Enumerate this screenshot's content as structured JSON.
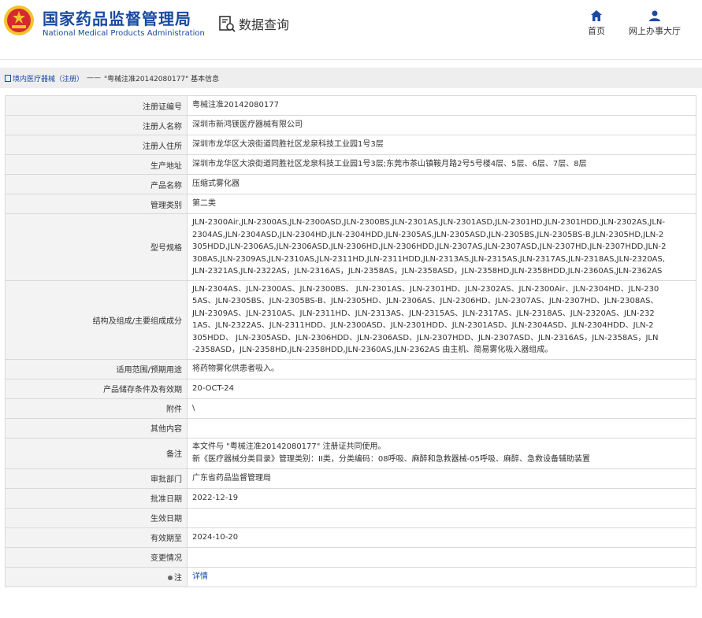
{
  "header": {
    "brand_cn": "国家药品监督管理局",
    "brand_en": "National Medical Products Administration",
    "search_title": "数据查询",
    "nav_home": "首页",
    "nav_office": "网上办事大厅"
  },
  "breadcrumb": {
    "link": "境内医疗器械（注册）",
    "separator": "——",
    "current": "\"粤械注准20142080177\" 基本信息"
  },
  "rows": [
    {
      "key": "注册证编号",
      "value": "粤械注准20142080177"
    },
    {
      "key": "注册人名称",
      "value": "深圳市新鸿镁医疗器械有限公司"
    },
    {
      "key": "注册人住所",
      "value": "深圳市龙华区大浪街道同胜社区龙泉科技工业园1号3层"
    },
    {
      "key": "生产地址",
      "value": "深圳市龙华区大浪街道同胜社区龙泉科技工业园1号3层;东莞市茶山镇鞍月路2号5号楼4层、5层、6层、7层、8层"
    },
    {
      "key": "产品名称",
      "value": "压缩式雾化器"
    },
    {
      "key": "管理类别",
      "value": "第二类"
    },
    {
      "key": "型号规格",
      "lines": [
        "JLN-2300Air,JLN-2300AS,JLN-2300ASD,JLN-2300BS,JLN-2301AS,JLN-2301ASD,JLN-2301HD,JLN-2301HDD,JLN-2302AS,JLN-",
        "2304AS,JLN-2304ASD,JLN-2304HD,JLN-2304HDD,JLN-2305AS,JLN-2305ASD,JLN-2305BS,JLN-2305BS-B,JLN-2305HD,JLN-2",
        "305HDD,JLN-2306AS,JLN-2306ASD,JLN-2306HD,JLN-2306HDD,JLN-2307AS,JLN-2307ASD,JLN-2307HD,JLN-2307HDD,JLN-2",
        "308AS,JLN-2309AS,JLN-2310AS,JLN-2311HD,JLN-2311HDD,JLN-2313AS,JLN-2315AS,JLN-2317AS,JLN-2318AS,JLN-2320AS,",
        "JLN-2321AS,JLN-2322AS，JLN-2316AS，JLN-2358AS，JLN-2358ASD，JLN-2358HD,JLN-2358HDD,JLN-2360AS,JLN-2362AS"
      ]
    },
    {
      "key": "结构及组成/主要组成成分",
      "lines": [
        "JLN-2304AS、JLN-2300AS、JLN-2300BS、 JLN-2301AS、JLN-2301HD、JLN-2302AS、JLN-2300Air、JLN-2304HD、JLN-230",
        "5AS、JLN-2305BS、JLN-2305BS-B、JLN-2305HD、JLN-2306AS、JLN-2306HD、JLN-2307AS、JLN-2307HD、JLN-2308AS、",
        "JLN-2309AS、JLN-2310AS、JLN-2311HD、JLN-2313AS、JLN-2315AS、JLN-2317AS、JLN-2318AS、JLN-2320AS、JLN-232",
        "1AS、JLN-2322AS、JLN-2311HDD、JLN-2300ASD、JLN-2301HDD、JLN-2301ASD、JLN-2304ASD、JLN-2304HDD、JLN-2",
        "305HDD、 JLN-2305ASD、JLN-2306HDD、JLN-2306ASD、JLN-2307HDD、JLN-2307ASD、JLN-2316AS，JLN-2358AS，JLN",
        "-2358ASD，JLN-2358HD,JLN-2358HDD,JLN-2360AS,JLN-2362AS 由主机、简易雾化吸入器组成。"
      ]
    },
    {
      "key": "适用范围/预期用途",
      "value": "将药物雾化供患者吸入。"
    },
    {
      "key": "产品储存条件及有效期",
      "value": "20-OCT-24"
    },
    {
      "key": "附件",
      "value": "\\"
    },
    {
      "key": "其他内容",
      "value": ""
    },
    {
      "key": "备注",
      "lines": [
        "本文件与 \"粤械注准20142080177\" 注册证共同使用。",
        "新《医疗器械分类目录》管理类别：II类，分类编码：08呼吸、麻醉和急救器械-05呼吸、麻醉、急救设备辅助装置"
      ]
    },
    {
      "key": "审批部门",
      "value": "广东省药品监督管理局"
    },
    {
      "key": "批准日期",
      "value": "2022-12-19"
    },
    {
      "key": "生效日期",
      "value": ""
    },
    {
      "key": "有效期至",
      "value": "2024-10-20"
    },
    {
      "key": "变更情况",
      "value": ""
    },
    {
      "key": "注",
      "value": "详情",
      "link": true
    }
  ],
  "colors": {
    "brand": "#1a4aa0",
    "logo_red": "#d7282f",
    "logo_gold": "#f2c230"
  }
}
